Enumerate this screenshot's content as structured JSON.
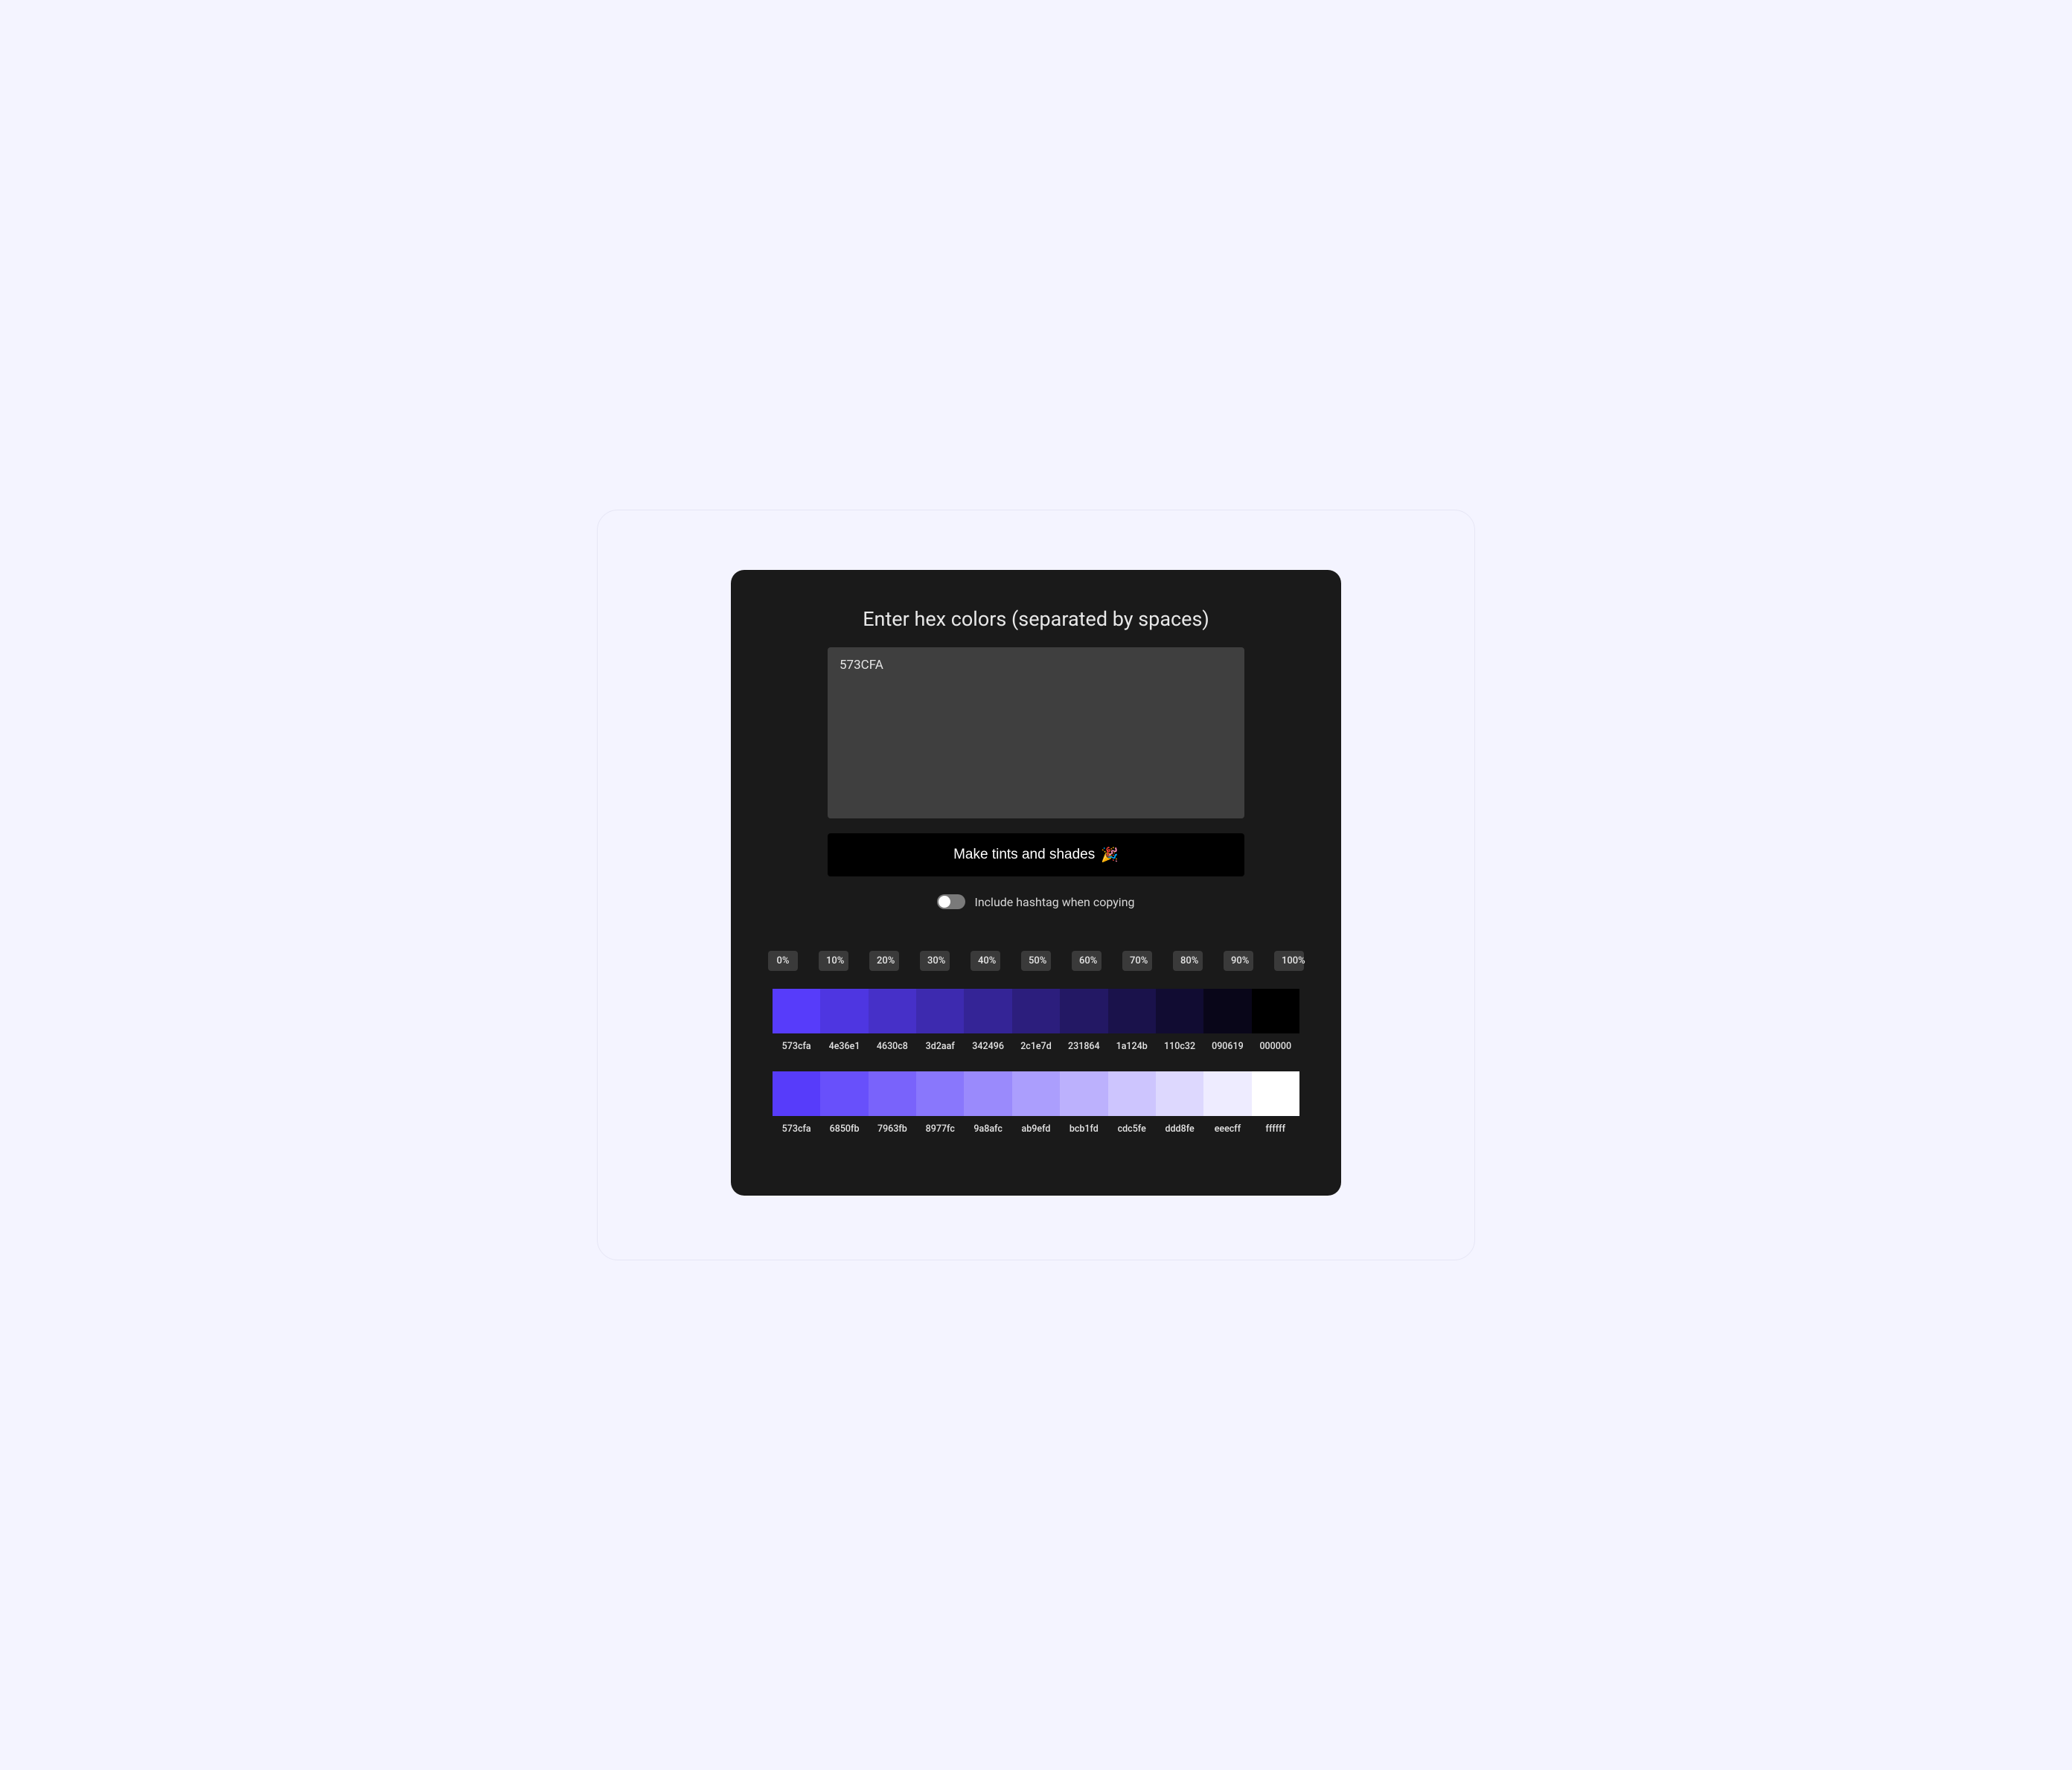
{
  "header": {
    "title": "Enter hex colors (separated by spaces)"
  },
  "input": {
    "value": "573CFA"
  },
  "actions": {
    "make_label": "Make tints and shades",
    "make_emoji": "🎉"
  },
  "toggle": {
    "label": "Include hashtag when copying",
    "on": false
  },
  "percents": [
    "0%",
    "10%",
    "20%",
    "30%",
    "40%",
    "50%",
    "60%",
    "70%",
    "80%",
    "90%",
    "100%"
  ],
  "shades": {
    "hexes": [
      "573cfa",
      "4e36e1",
      "4630c8",
      "3d2aaf",
      "342496",
      "2c1e7d",
      "231864",
      "1a124b",
      "110c32",
      "090619",
      "000000"
    ],
    "colors": [
      "#573cfa",
      "#4e36e1",
      "#4630c8",
      "#3d2aaf",
      "#342496",
      "#2c1e7d",
      "#231864",
      "#1a124b",
      "#110c32",
      "#090619",
      "#000000"
    ]
  },
  "tints": {
    "hexes": [
      "573cfa",
      "6850fb",
      "7963fb",
      "8977fc",
      "9a8afc",
      "ab9efd",
      "bcb1fd",
      "cdc5fe",
      "ddd8fe",
      "eeecff",
      "ffffff"
    ],
    "colors": [
      "#573cfa",
      "#6850fb",
      "#7963fb",
      "#8977fc",
      "#9a8afc",
      "#ab9efd",
      "#bcb1fd",
      "#cdc5fe",
      "#ddd8fe",
      "#eeecff",
      "#ffffff"
    ]
  }
}
